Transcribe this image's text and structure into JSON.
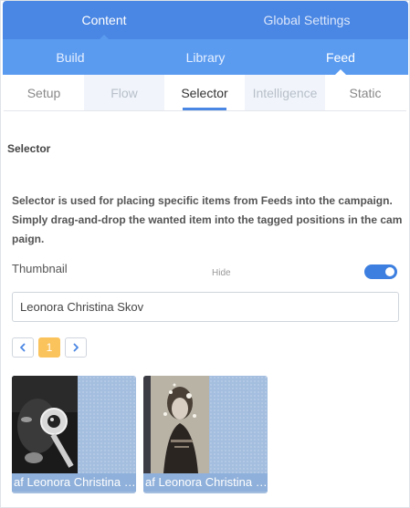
{
  "top_tabs": [
    {
      "label": "Content",
      "active": true
    },
    {
      "label": "Global Settings",
      "active": false
    }
  ],
  "sub_tabs": [
    {
      "label": "Build",
      "active": false
    },
    {
      "label": "Library",
      "active": false
    },
    {
      "label": "Feed",
      "active": true
    }
  ],
  "third_tabs": [
    {
      "label": "Setup",
      "state": "normal"
    },
    {
      "label": "Flow",
      "state": "disabled"
    },
    {
      "label": "Selector",
      "state": "active"
    },
    {
      "label": "Intelligence",
      "state": "disabled"
    },
    {
      "label": "Static",
      "state": "normal"
    }
  ],
  "section_title": "Selector",
  "description": "Selector is used for placing specific items from Feeds into the campaign. Simply drag-and-drop the wanted item into the tagged positions in the campaign.",
  "thumbnail": {
    "label": "Thumbnail",
    "hide_label": "Hide",
    "toggle_on": true
  },
  "search": {
    "value": "Leonora Christina Skov"
  },
  "pagination": {
    "current_page": "1"
  },
  "items": [
    {
      "caption": "af Leonora Christina Skov",
      "image": "book-cover-magnifying-glass"
    },
    {
      "caption": "af Leonora Christina Skov",
      "image": "book-cover-woman-portrait"
    }
  ],
  "colors": {
    "accent": "#4a86e3",
    "subtab": "#5a9bf0",
    "page_current": "#fbc35b",
    "item_bg": "#a4bedf"
  }
}
